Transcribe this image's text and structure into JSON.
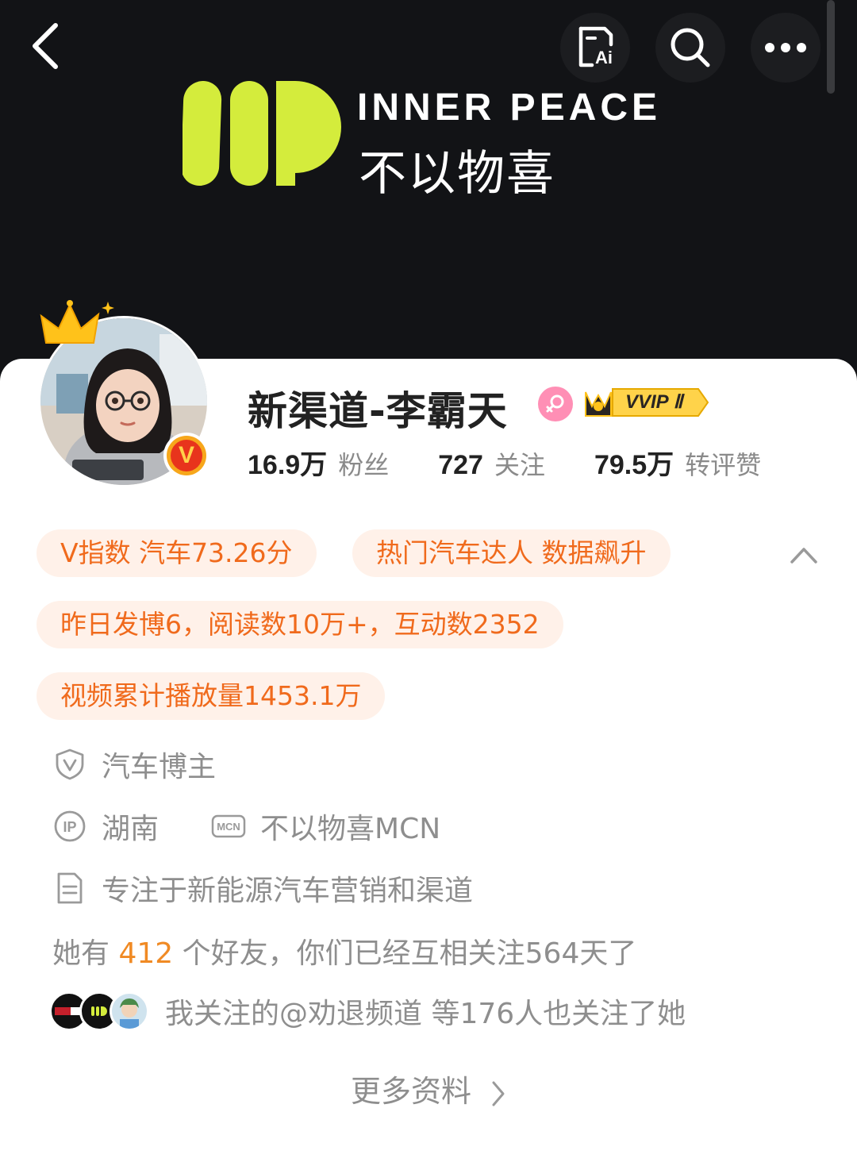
{
  "banner": {
    "brand_en": "INNER PEACE",
    "brand_cn": "不以物喜",
    "background_color": "#121316",
    "accent_color": "#d4ec3c"
  },
  "top_bar": {
    "back_icon": "chevron-left-icon",
    "ai_icon": "ai-summary-icon",
    "ai_icon_label": "Ai",
    "search_icon": "search-icon",
    "more_icon": "more-dots-icon"
  },
  "profile": {
    "name": "新渠道-李霸天",
    "verified_badge": "V",
    "gender_icon": "female-icon",
    "vip_badge": "VVIP Ⅱ",
    "stats": [
      {
        "value": "16.9万",
        "label": "粉丝"
      },
      {
        "value": "727",
        "label": "关注"
      },
      {
        "value": "79.5万",
        "label": "转评赞"
      }
    ]
  },
  "tags": {
    "tag1": "V指数 汽车73.26分",
    "tag2": "热门汽车达人 数据飙升",
    "tag3": "昨日发博6，阅读数10万+，互动数2352",
    "tag4": "视频累计播放量1453.1万"
  },
  "info": {
    "role": "汽车博主",
    "ip_icon_label": "IP",
    "location": "湖南",
    "mcn_icon_label": "MCN",
    "mcn": "不以物喜MCN",
    "bio": "专注于新能源汽车营销和渠道"
  },
  "friends": {
    "prefix": "她有",
    "count": "412",
    "suffix": "个好友，你们已经互相关注564天了"
  },
  "mutual": {
    "text": "我关注的@劝退频道 等176人也关注了她"
  },
  "more_info": {
    "label": "更多资料"
  },
  "colors": {
    "tag_bg": "#fff1e9",
    "tag_text": "#f06a1c",
    "highlight": "#f08a24",
    "verified": "#e8341c"
  }
}
